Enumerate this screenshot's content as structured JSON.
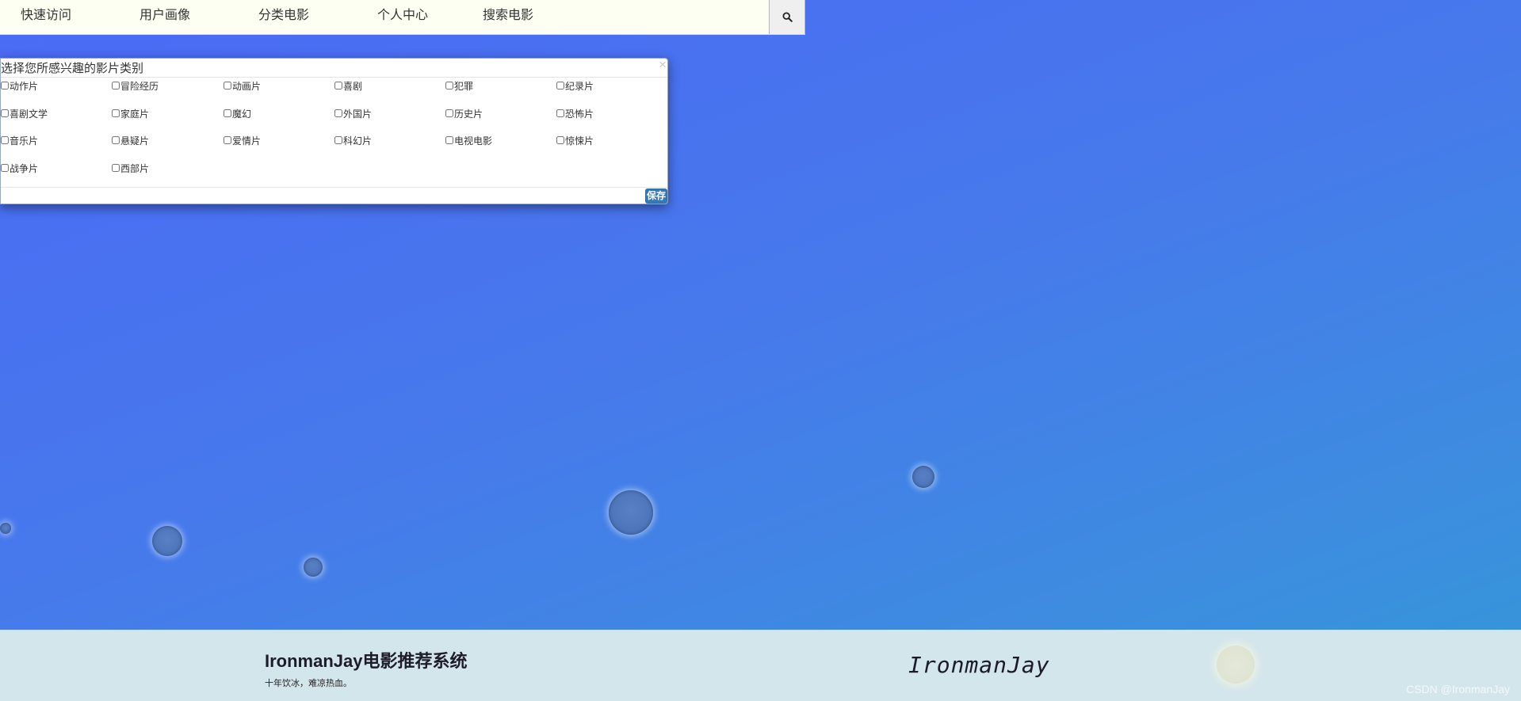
{
  "nav": {
    "items": [
      "快速访问",
      "用户画像",
      "分类电影",
      "个人中心",
      "搜索电影"
    ]
  },
  "modal": {
    "title": "选择您所感兴趣的影片类别",
    "close_label": "×",
    "genres": [
      "动作片",
      "冒险经历",
      "动画片",
      "喜剧",
      "犯罪",
      "纪录片",
      "喜剧文学",
      "家庭片",
      "魔幻",
      "外国片",
      "历史片",
      "恐怖片",
      "音乐片",
      "悬疑片",
      "爱情片",
      "科幻片",
      "电视电影",
      "惊悚片",
      "战争片",
      "西部片"
    ],
    "save_label": "保存"
  },
  "footer": {
    "title": "IronmanJay电影推荐系统",
    "slogan": "十年饮冰，难凉热血。",
    "signature": "IronmanJay"
  },
  "watermark": "CSDN @IronmanJay",
  "colors": {
    "nav_bg": "#fdfff3",
    "save_button": "#337ab7",
    "footer_bg": "#d3e6ec"
  },
  "icons": {
    "search": "magnifier-icon"
  }
}
